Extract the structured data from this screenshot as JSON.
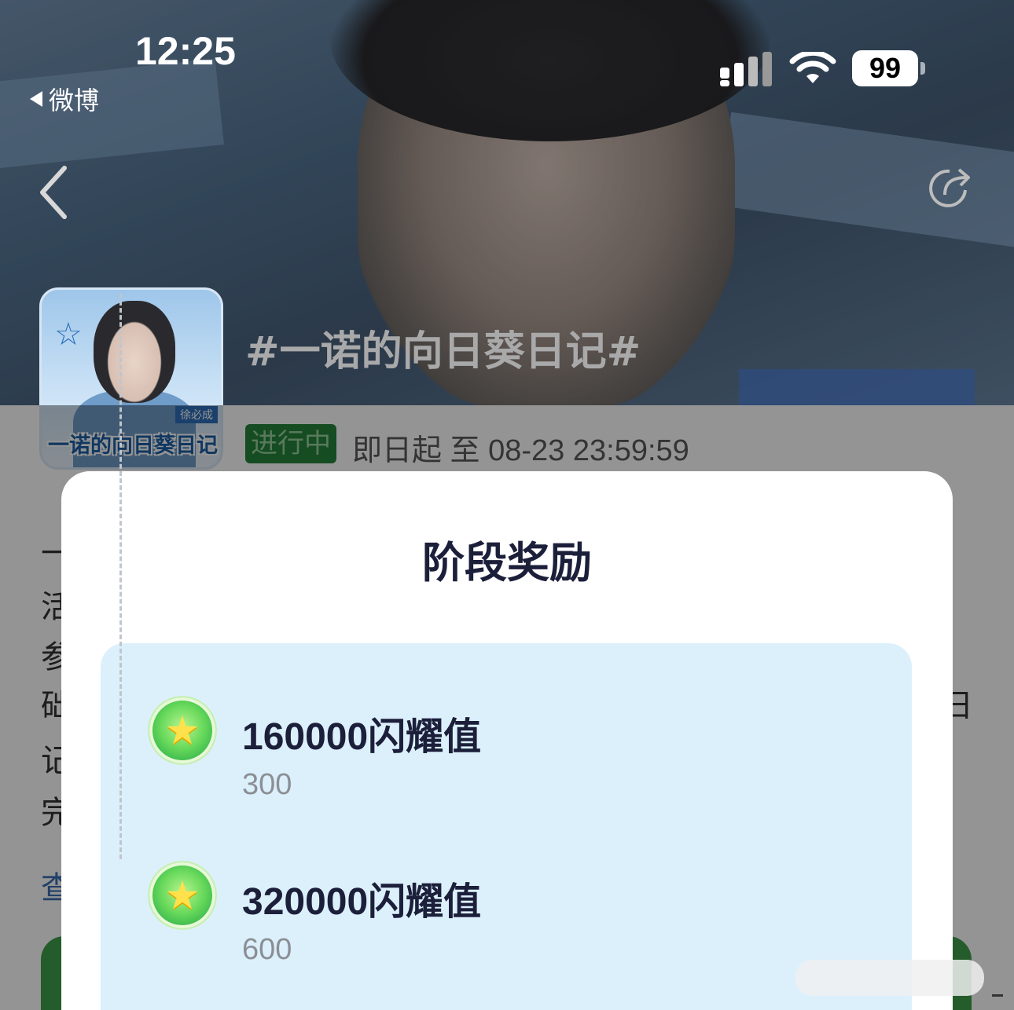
{
  "status_bar": {
    "time": "12:25",
    "back_app_label": "微博",
    "battery": "99",
    "signal_icon": "signal-bars",
    "wifi_icon": "wifi"
  },
  "nav": {
    "back_icon": "chevron-left",
    "share_icon": "share"
  },
  "topic": {
    "title": "#一诺的向日葵日记#",
    "avatar_text": "一诺的向日葵日记",
    "avatar_tag": "徐必成",
    "status": "进行中",
    "period": "即日起 至 08-23 23:59:59"
  },
  "background": {
    "desc_chars": [
      "一",
      "活",
      "参",
      "础",
      "记",
      "完"
    ],
    "desc_right_char": "日",
    "view_link_char": "查"
  },
  "modal": {
    "title": "阶段奖励",
    "rewards": [
      {
        "name": "160000闪耀值",
        "value": "300",
        "icon": "green-star-badge"
      },
      {
        "name": "320000闪耀值",
        "value": "600",
        "icon": "green-star-badge"
      }
    ]
  },
  "colors": {
    "status_green": "#25843a",
    "panel_bg": "#dcf0fc",
    "title_text": "#1c1f3a",
    "value_text": "#8b8f95"
  }
}
